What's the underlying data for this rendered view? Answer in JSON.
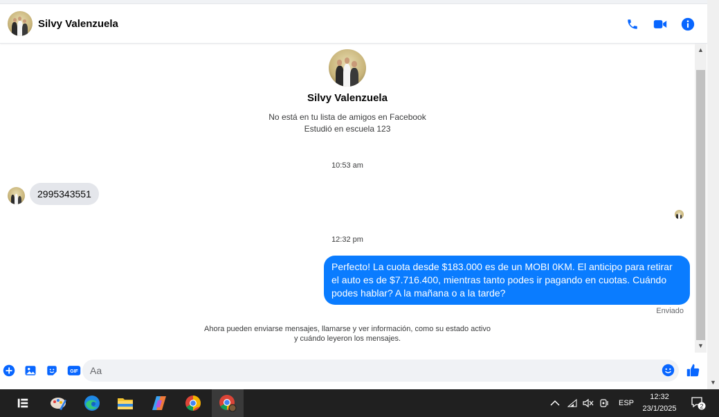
{
  "header": {
    "contact_name": "Silvy Valenzuela",
    "actions": [
      "phone-icon",
      "video-icon",
      "info-icon"
    ]
  },
  "profile": {
    "name": "Silvy Valenzuela",
    "line1": "No está en tu lista de amigos en Facebook",
    "line2": "Estudió en escuela 123"
  },
  "messages": {
    "time1": "10:53 am",
    "incoming_text": "2995343551",
    "time2": "12:32 pm",
    "outgoing_text": "Perfecto! La cuota desde $183.000 es de un MOBI 0KM. El anticipo para retirar el auto es de $7.716.400, mientras tanto podes ir pagando en cuotas. Cuándo podes hablar? A la mañana o a la tarde?",
    "status": "Enviado"
  },
  "notice": {
    "line1": "Ahora pueden enviarse mensajes, llamarse y ver información, como su estado activo",
    "line2": "y cuándo leyeron los mensajes."
  },
  "composer": {
    "placeholder": "Aa",
    "gif_label": "GIF"
  },
  "taskbar": {
    "language": "ESP",
    "time": "12:32",
    "date": "23/1/2025",
    "notifications": "2"
  },
  "colors": {
    "accent": "#0866ff",
    "bubble_out": "#0a7cff",
    "bubble_in": "#e4e6eb"
  }
}
